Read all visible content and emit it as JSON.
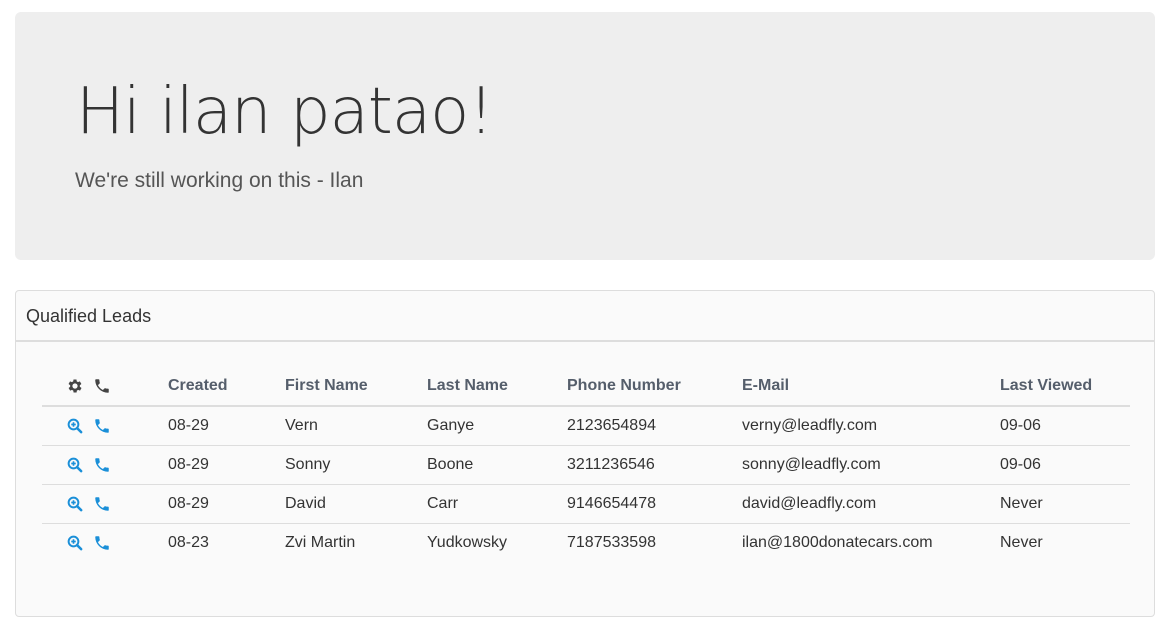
{
  "jumbotron": {
    "greeting": "Hi ilan patao!",
    "subtitle": "We're still working on this - Ilan"
  },
  "panel": {
    "title": "Qualified Leads"
  },
  "table": {
    "header_icons": [
      "gear-icon",
      "phone-icon"
    ],
    "row_icons": [
      "zoom-in-icon",
      "phone-icon"
    ],
    "columns": {
      "created": "Created",
      "first_name": "First Name",
      "last_name": "Last Name",
      "phone": "Phone Number",
      "email": "E-Mail",
      "last_viewed": "Last Viewed"
    },
    "rows": [
      {
        "created": "08-29",
        "first_name": "Vern",
        "last_name": "Ganye",
        "phone": "2123654894",
        "email": "verny@leadfly.com",
        "last_viewed": "09-06"
      },
      {
        "created": "08-29",
        "first_name": "Sonny",
        "last_name": "Boone",
        "phone": "3211236546",
        "email": "sonny@leadfly.com",
        "last_viewed": "09-06"
      },
      {
        "created": "08-29",
        "first_name": "David",
        "last_name": "Carr",
        "phone": "9146654478",
        "email": "david@leadfly.com",
        "last_viewed": "Never"
      },
      {
        "created": "08-23",
        "first_name": "Zvi Martin",
        "last_name": "Yudkowsky",
        "phone": "7187533598",
        "email": "ilan@1800donatecars.com",
        "last_viewed": "Never"
      }
    ]
  },
  "colors": {
    "jumbotron_bg": "#eeeeee",
    "panel_bg": "#fafafa",
    "header_text": "#555e6b",
    "icon_blue": "#1a8fd8",
    "icon_dark": "#444444"
  }
}
